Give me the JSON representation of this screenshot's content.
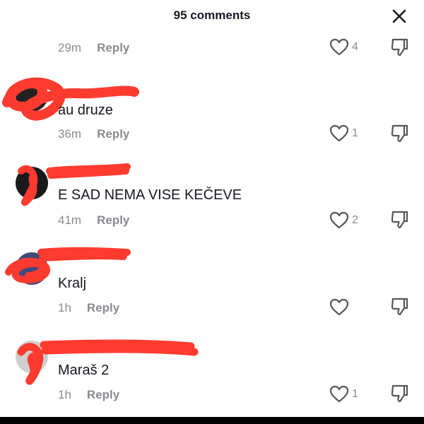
{
  "header": {
    "title": "95 comments"
  },
  "comments": [
    {
      "text": "",
      "time": "29m",
      "reply": "Reply",
      "likes": "4"
    },
    {
      "text": "au druze",
      "time": "36m",
      "reply": "Reply",
      "likes": "1"
    },
    {
      "text": "E SAD NEMA VISE KEČEVE",
      "time": "41m",
      "reply": "Reply",
      "likes": "2"
    },
    {
      "text": "Kralj",
      "time": "1h",
      "reply": "Reply",
      "likes": ""
    },
    {
      "text": "Maraš 2",
      "time": "1h",
      "reply": "Reply",
      "likes": "1"
    }
  ],
  "colors": {
    "redaction": "#ff3b30",
    "muted": "#8a8b91",
    "text": "#161823"
  },
  "icons": {
    "close": "close-icon",
    "like": "heart-icon",
    "dislike": "dislike-icon"
  }
}
